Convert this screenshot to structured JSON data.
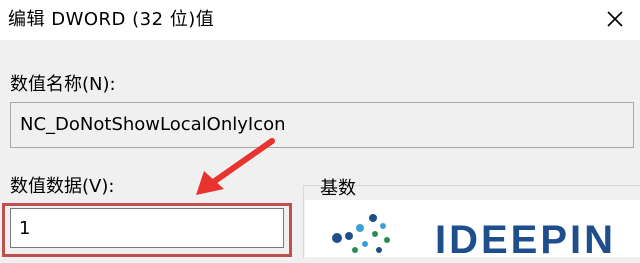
{
  "window": {
    "title": "编辑 DWORD (32 位)值",
    "close_icon": "close-icon"
  },
  "value_name": {
    "label": "数值名称(N):",
    "value": "NC_DoNotShowLocalOnlyIcon"
  },
  "value_data": {
    "label": "数值数据(V):",
    "value": "1"
  },
  "base": {
    "label": "基数"
  },
  "overlay": {
    "watermark_text": "IDEEPIN",
    "highlight_color": "#c0504d",
    "arrow_color": "#e8332e"
  }
}
